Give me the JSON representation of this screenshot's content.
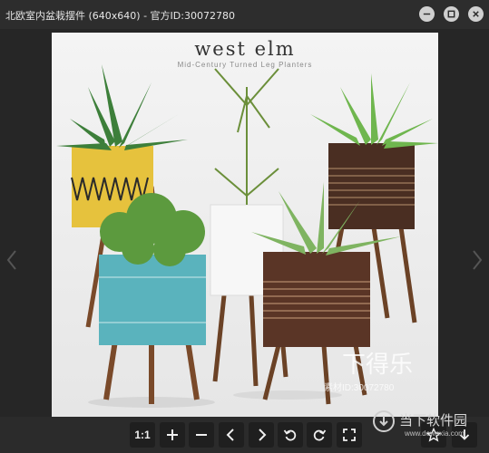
{
  "window": {
    "title": "北欧室内盆栽摆件 (640x640) - 官方ID:30072780",
    "minimize_icon": "minimize-icon",
    "maximize_icon": "maximize-icon",
    "close_icon": "close-icon"
  },
  "viewer": {
    "prev_icon": "chevron-left-icon",
    "next_icon": "chevron-right-icon",
    "image": {
      "brand": "west elm",
      "brand_subtitle": "Mid-Century Turned Leg Planters",
      "watermark": "下得乐",
      "watermark_id": "素材ID:30072780"
    }
  },
  "toolbar": {
    "ratio_label": "1:1",
    "buttons": [
      "zoom-in-icon",
      "zoom-out-icon",
      "previous-icon",
      "next-icon",
      "rotate-left-icon",
      "rotate-right-icon",
      "fullscreen-icon",
      "favorite-icon",
      "download-icon"
    ]
  },
  "site_watermark": {
    "name": "当下软件园",
    "url": "www.downxia.com"
  }
}
